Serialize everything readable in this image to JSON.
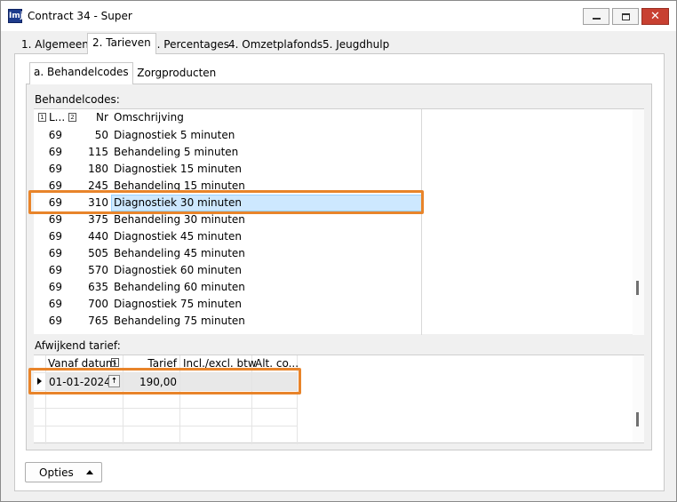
{
  "window": {
    "title": "Contract 34 - Super",
    "icon_text": "Imj",
    "controls": {
      "minimize": "minimize-icon",
      "maximize": "maximize-icon",
      "close": "✕"
    }
  },
  "tabs": [
    {
      "label": "1. Algemeen"
    },
    {
      "label": "2. Tarieven"
    },
    {
      "label": "3. Percentages"
    },
    {
      "label": "4. Omzetplafonds"
    },
    {
      "label": "5. Jeugdhulp"
    }
  ],
  "subtabs": [
    {
      "label": "a. Behandelcodes"
    },
    {
      "label": "b. Zorgproducten"
    }
  ],
  "behandelcodes": {
    "label": "Behandelcodes:",
    "columns": {
      "l": "L...",
      "nr": "Nr",
      "omschrijving": "Omschrijving",
      "sort1": "1",
      "sort2": "2"
    },
    "rows": [
      {
        "l": "69",
        "nr": "50",
        "omschrijving": "Diagnostiek 5 minuten"
      },
      {
        "l": "69",
        "nr": "115",
        "omschrijving": "Behandeling 5 minuten"
      },
      {
        "l": "69",
        "nr": "180",
        "omschrijving": "Diagnostiek 15 minuten"
      },
      {
        "l": "69",
        "nr": "245",
        "omschrijving": "Behandeling 15 minuten"
      },
      {
        "l": "69",
        "nr": "310",
        "omschrijving": "Diagnostiek 30 minuten"
      },
      {
        "l": "69",
        "nr": "375",
        "omschrijving": "Behandeling 30 minuten"
      },
      {
        "l": "69",
        "nr": "440",
        "omschrijving": "Diagnostiek 45 minuten"
      },
      {
        "l": "69",
        "nr": "505",
        "omschrijving": "Behandeling 45 minuten"
      },
      {
        "l": "69",
        "nr": "570",
        "omschrijving": "Diagnostiek 60 minuten"
      },
      {
        "l": "69",
        "nr": "635",
        "omschrijving": "Behandeling 60 minuten"
      },
      {
        "l": "69",
        "nr": "700",
        "omschrijving": "Diagnostiek 75 minuten"
      },
      {
        "l": "69",
        "nr": "765",
        "omschrijving": "Behandeling 75 minuten"
      }
    ],
    "selected_row": 4
  },
  "afwijkend": {
    "label": "Afwijkend tarief:",
    "columns": {
      "vanaf": "Vanaf datum",
      "sort1": "1",
      "tarief": "Tarief",
      "incl": "Incl./excl. btw",
      "alt": "Alt. co..."
    },
    "rows": [
      {
        "vanaf": "01-01-2024",
        "tarief": "190,00",
        "incl": "",
        "alt": ""
      }
    ],
    "date_button_glyph": "🠅"
  },
  "footer": {
    "opties_label": "Opties"
  },
  "colors": {
    "highlight": "#e8842a",
    "selection": "#cde8ff",
    "close_button": "#c84031"
  }
}
